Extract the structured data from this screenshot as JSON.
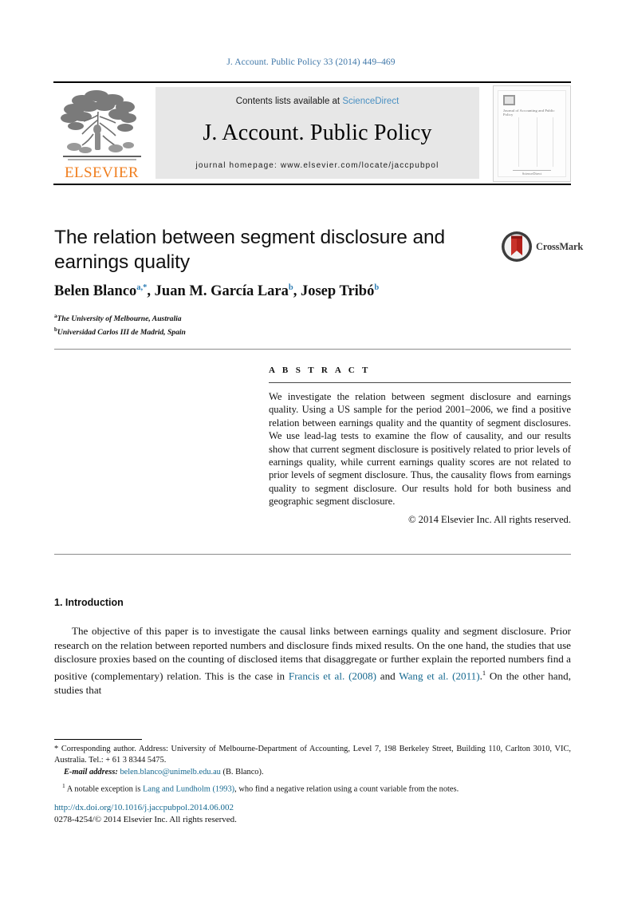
{
  "running_head": "J. Account. Public Policy 33 (2014) 449–469",
  "masthead": {
    "publisher_wordmark": "ELSEVIER",
    "contents_prefix": "Contents lists available at ",
    "sciencedirect_link": "ScienceDirect",
    "journal_name": "J. Account. Public Policy",
    "homepage_line": "journal homepage: www.elsevier.com/locate/jaccpubpol",
    "cover": {
      "title": "Journal of Accounting and Public Policy",
      "footer": "ScienceDirect"
    }
  },
  "article": {
    "title": "The relation between segment disclosure and earnings quality",
    "authors": [
      {
        "name": "Belen Blanco",
        "marks": "a,*"
      },
      {
        "name": "Juan M. García Lara",
        "marks": "b"
      },
      {
        "name": "Josep Tribó",
        "marks": "b"
      }
    ],
    "affiliations": [
      {
        "mark": "a",
        "text": "The University of Melbourne, Australia"
      },
      {
        "mark": "b",
        "text": "Universidad Carlos III de Madrid, Spain"
      }
    ],
    "crossmark_label": "CrossMark"
  },
  "abstract": {
    "heading": "A B S T R A C T",
    "text": "We investigate the relation between segment disclosure and earnings quality. Using a US sample for the period 2001–2006, we find a positive relation between earnings quality and the quantity of segment disclosures. We use lead-lag tests to examine the flow of causality, and our results show that current segment disclosure is positively related to prior levels of earnings quality, while current earnings quality scores are not related to prior levels of segment disclosure. Thus, the causality flows from earnings quality to segment disclosure. Our results hold for both business and geographic segment disclosure.",
    "copyright": "© 2014 Elsevier Inc. All rights reserved."
  },
  "body": {
    "section_heading": "1. Introduction",
    "paragraph_part1": "The objective of this paper is to investigate the causal links between earnings quality and segment disclosure. Prior research on the relation between reported numbers and disclosure finds mixed results. On the one hand, the studies that use disclosure proxies based on the counting of disclosed items that disaggregate or further explain the reported numbers find a positive (complementary) relation. This is the case in ",
    "citation_1": "Francis et al. (2008)",
    "paragraph_joiner": " and ",
    "citation_2": "Wang et al. (2011)",
    "footnote_marker": "1",
    "paragraph_part2": " On the other hand, studies that"
  },
  "footnotes": {
    "corresponding": "* Corresponding author. Address: University of Melbourne-Department of Accounting, Level 7, 198 Berkeley Street, Building 110, Carlton 3010, VIC, Australia. Tel.: + 61 3 8344 5475.",
    "email_label": "E-mail address:",
    "email_value": "belen.blanco@unimelb.edu.au",
    "email_suffix": " (B. Blanco).",
    "note1_marker": "1",
    "note1_prefix": " A notable exception is ",
    "note1_citation": "Lang and Lundholm (1993)",
    "note1_suffix": ", who find a negative relation using a count variable from the notes."
  },
  "imprint": {
    "doi": "http://dx.doi.org/10.1016/j.jaccpubpol.2014.06.002",
    "issn_line": "0278-4254/© 2014 Elsevier Inc. All rights reserved."
  },
  "colors": {
    "link_blue": "#15688f",
    "running_head_blue": "#3f77a8",
    "sciencedirect_blue": "#4a90c2",
    "elsevier_orange": "#f07f20",
    "banner_gray": "#e7e7e7"
  }
}
